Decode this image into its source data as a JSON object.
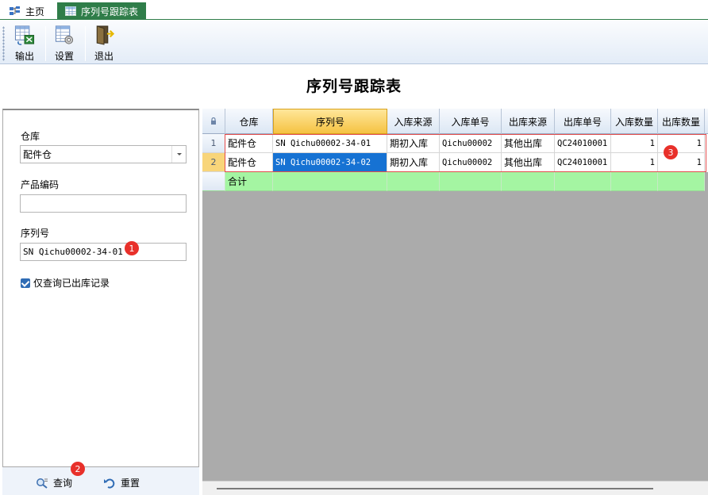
{
  "tabs": {
    "home": "主页",
    "active": "序列号跟踪表"
  },
  "toolbar": {
    "export_label": "输出",
    "settings_label": "设置",
    "exit_label": "退出"
  },
  "page": {
    "title": "序列号跟踪表"
  },
  "filters": {
    "warehouse_label": "仓库",
    "warehouse_value": "配件仓",
    "product_code_label": "产品编码",
    "product_code_value": "",
    "serial_label": "序列号",
    "serial_value": "SN Qichu00002-34-01",
    "only_outbound_label": "仅查询已出库记录",
    "only_outbound_checked": true
  },
  "actions": {
    "query_label": "查询",
    "reset_label": "重置"
  },
  "badges": {
    "one": "1",
    "two": "2",
    "three": "3"
  },
  "grid": {
    "columns": [
      "仓库",
      "序列号",
      "入库来源",
      "入库单号",
      "出库来源",
      "出库单号",
      "入库数量",
      "出库数量"
    ],
    "rows": [
      {
        "index": "1",
        "warehouse": "配件仓",
        "serial": "SN Qichu00002-34-01",
        "in_source": "期初入库",
        "in_no": "Qichu00002",
        "out_source": "其他出库",
        "out_no": "QC24010001",
        "in_qty": "1",
        "out_qty": "1"
      },
      {
        "index": "2",
        "warehouse": "配件仓",
        "serial": "SN Qichu00002-34-02",
        "in_source": "期初入库",
        "in_no": "Qichu00002",
        "out_source": "其他出库",
        "out_no": "QC24010001",
        "in_qty": "1",
        "out_qty": "1"
      }
    ],
    "summary_label": "合计"
  },
  "colors": {
    "tab_active": "#2f7d49",
    "selected_cell": "#1672d3",
    "summary_row": "#a4f5a2",
    "badge": "#e8302a"
  }
}
